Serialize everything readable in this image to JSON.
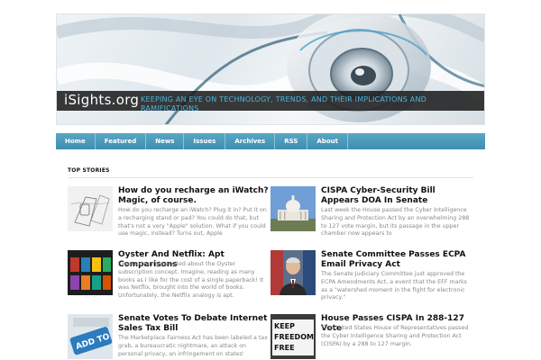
{
  "header": {
    "site_name": "iSights.org",
    "tagline": "Keeping an eye on technology, trends, and their implications and ramifications"
  },
  "nav": {
    "items": [
      {
        "label": "Home"
      },
      {
        "label": "Featured"
      },
      {
        "label": "News"
      },
      {
        "label": "Issues"
      },
      {
        "label": "Archives"
      },
      {
        "label": "RSS"
      },
      {
        "label": "About"
      }
    ]
  },
  "section": {
    "title": "TOP STORIES"
  },
  "stories": [
    {
      "title": "How do you recharge an iWatch? Magic, of course.",
      "excerpt": "How do you recharge an iWatch? Plug it in? Put it on a recharging stand or pad? You could do that, but that's not a very \"Apple\" solution. What if you could use magic, instead? Turns out, Apple"
    },
    {
      "title": "CISPA Cyber-Security Bill Appears DOA In Senate",
      "excerpt": "Last week the House passed the Cyber Intelligence Sharing and Protection Act by an overwhelming 288 to 127 vote margin, but its passage in the upper chamber now appears to"
    },
    {
      "title": "Oyster And Netflix: Apt Comparisons",
      "excerpt": "I was extremely excited about the Oyster subscription concept. Imagine, reading as many books as I like for the cost of a single paperback! It was Netflix, brought into the world of books. Unfortunately, the Netflix analogy is apt."
    },
    {
      "title": "Senate Committee Passes ECPA Email Privacy Act",
      "excerpt": "The Senate Judiciary Committee just approved the ECPA Amendments Act, a event that the EFF marks as a \"watershed moment in the fight for electronic privacy.\""
    },
    {
      "title": "Senate Votes To Debate Internet Sales Tax Bill",
      "excerpt": "The Marketplace Fairness Act has been labeled a tax grab, a bureaucratic nightmare, an attack on personal privacy, an infringement on states'"
    },
    {
      "title": "House Passes CISPA In 288-127 Vote",
      "excerpt": "The United States House of Representatives passed the Cyber Intelligence Sharing and Protection Act (CISPA) by a 288 to 127 margin."
    }
  ],
  "thumbs": {
    "ad_label": "ADD TO",
    "sign_line1": "KEEP",
    "sign_line2": "FREEDOM",
    "sign_line3": "FREE"
  }
}
